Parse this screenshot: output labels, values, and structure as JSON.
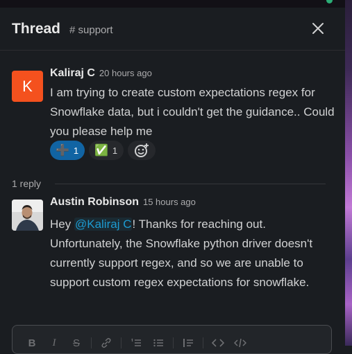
{
  "thread": {
    "title": "Thread",
    "channel": "# support"
  },
  "message1": {
    "avatar_initial": "K",
    "author": "Kaliraj C",
    "time": "20 hours ago",
    "text": "I am trying to create custom expectations regex for Snowflake data, but i couldn't get the guidance.. Could you please help me",
    "reactions": [
      {
        "emoji": "➕",
        "count": "1"
      },
      {
        "emoji": "✅",
        "count": "1"
      }
    ]
  },
  "replies_label": "1 reply",
  "message2": {
    "author": "Austin Robinson",
    "time": "15 hours ago",
    "text_before": "Hey ",
    "mention": "@Kaliraj C",
    "text_after": "! Thanks for reaching out. Unfortunately, the Snowflake python driver doesn't currently support regex, and so we are unable to support custom regex expectations for snowflake."
  },
  "composer": {
    "tools": [
      "bold-icon",
      "italic-icon",
      "strikethrough-icon",
      "link-icon",
      "ordered-list-icon",
      "bulleted-list-icon",
      "blockquote-icon",
      "code-icon",
      "code-block-icon"
    ]
  },
  "colors": {
    "background": "#1a1d21",
    "accent_blue": "#1164a3",
    "mention_blue": "#1d9bd1",
    "avatar_orange": "#f4511e"
  }
}
